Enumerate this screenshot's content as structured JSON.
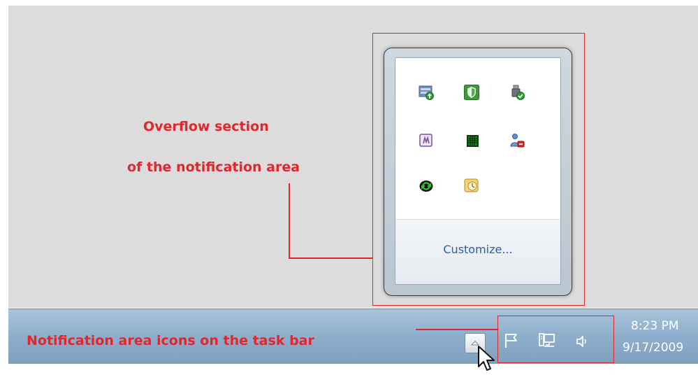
{
  "annotations": {
    "overflow_line1": "Overflow section",
    "overflow_line2": "of the notification area",
    "taskbar_label": "Notification area icons on the task bar"
  },
  "popup": {
    "customize_label": "Customize...",
    "icons": [
      "update-icon",
      "security-shield-icon",
      "usb-device-icon",
      "onenote-icon",
      "matrix-icon",
      "user-status-icon",
      "sync-icon",
      "reminder-icon"
    ]
  },
  "taskbar": {
    "clock_time": "8:23 PM",
    "clock_date": "9/17/2009",
    "tray_icons": [
      "action-center-flag-icon",
      "network-icon",
      "volume-icon"
    ]
  },
  "colors": {
    "annotation_red": "#e0262b",
    "link_blue": "#2a5db0"
  }
}
